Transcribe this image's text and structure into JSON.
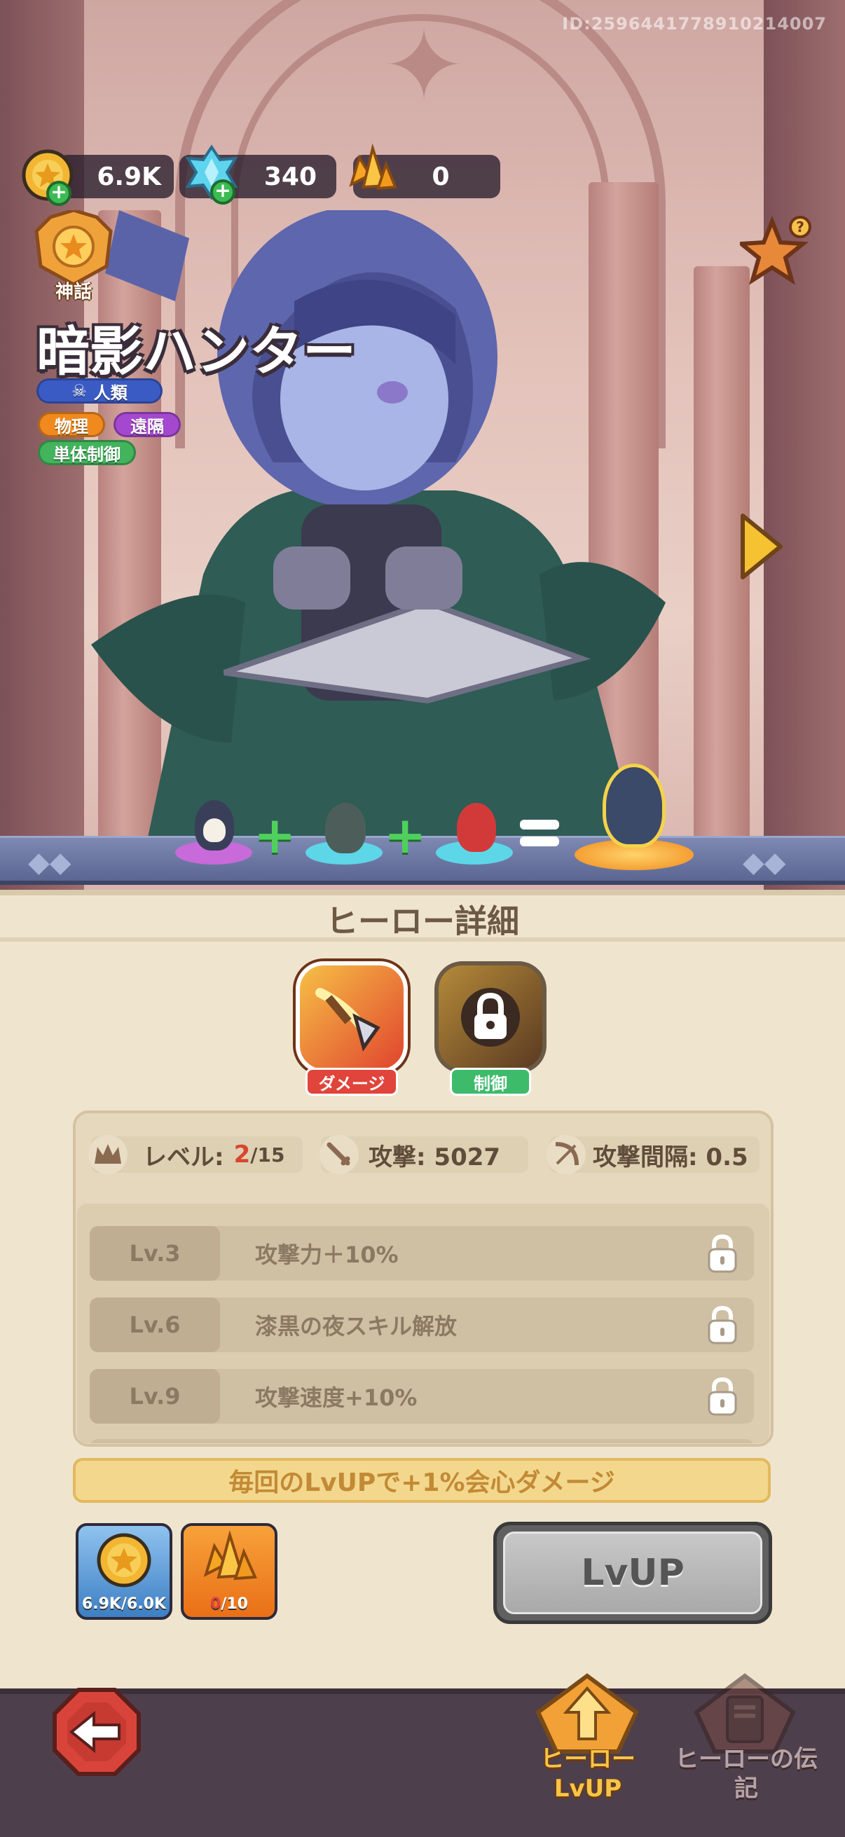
{
  "header": {
    "player_id": "ID:2596441778910214007",
    "resources": {
      "gold": "6.9K",
      "gems": "340",
      "crystals": "0"
    }
  },
  "hero": {
    "rarity": "神話",
    "name": "暗影ハンター",
    "race": "人類",
    "tags": [
      "物理",
      "遠隔",
      "単体制御"
    ]
  },
  "panel": {
    "title": "ヒーロー詳細",
    "skills": [
      {
        "label": "ダメージ",
        "locked": false
      },
      {
        "label": "制御",
        "locked": true
      }
    ],
    "stats": {
      "level_label": "レベル:",
      "level_current": "2",
      "level_max": "/15",
      "attack": "攻撃: 5027",
      "interval": "攻撃間隔: 0.5"
    },
    "unlocks": [
      {
        "level": "Lv.3",
        "text": "攻撃力＋10%"
      },
      {
        "level": "Lv.6",
        "text": "漆黒の夜スキル解放"
      },
      {
        "level": "Lv.9",
        "text": "攻撃速度+10%"
      }
    ],
    "bonus": "毎回のLvUPで+1%会心ダメージ",
    "costs": {
      "gold": "6.9K/6.0K",
      "crystal_have": "0",
      "crystal_need": "/10"
    },
    "lvup_label": "LvUP"
  },
  "nav": {
    "hero_lvup": "ヒーローLvUP",
    "hero_lore": "ヒーローの伝記"
  },
  "colors": {
    "gold": "#f2b632",
    "accent_orange": "#f0821e",
    "panel_bg": "#efe5cf",
    "damage_red": "#e0443a",
    "control_green": "#3dbb6b"
  }
}
